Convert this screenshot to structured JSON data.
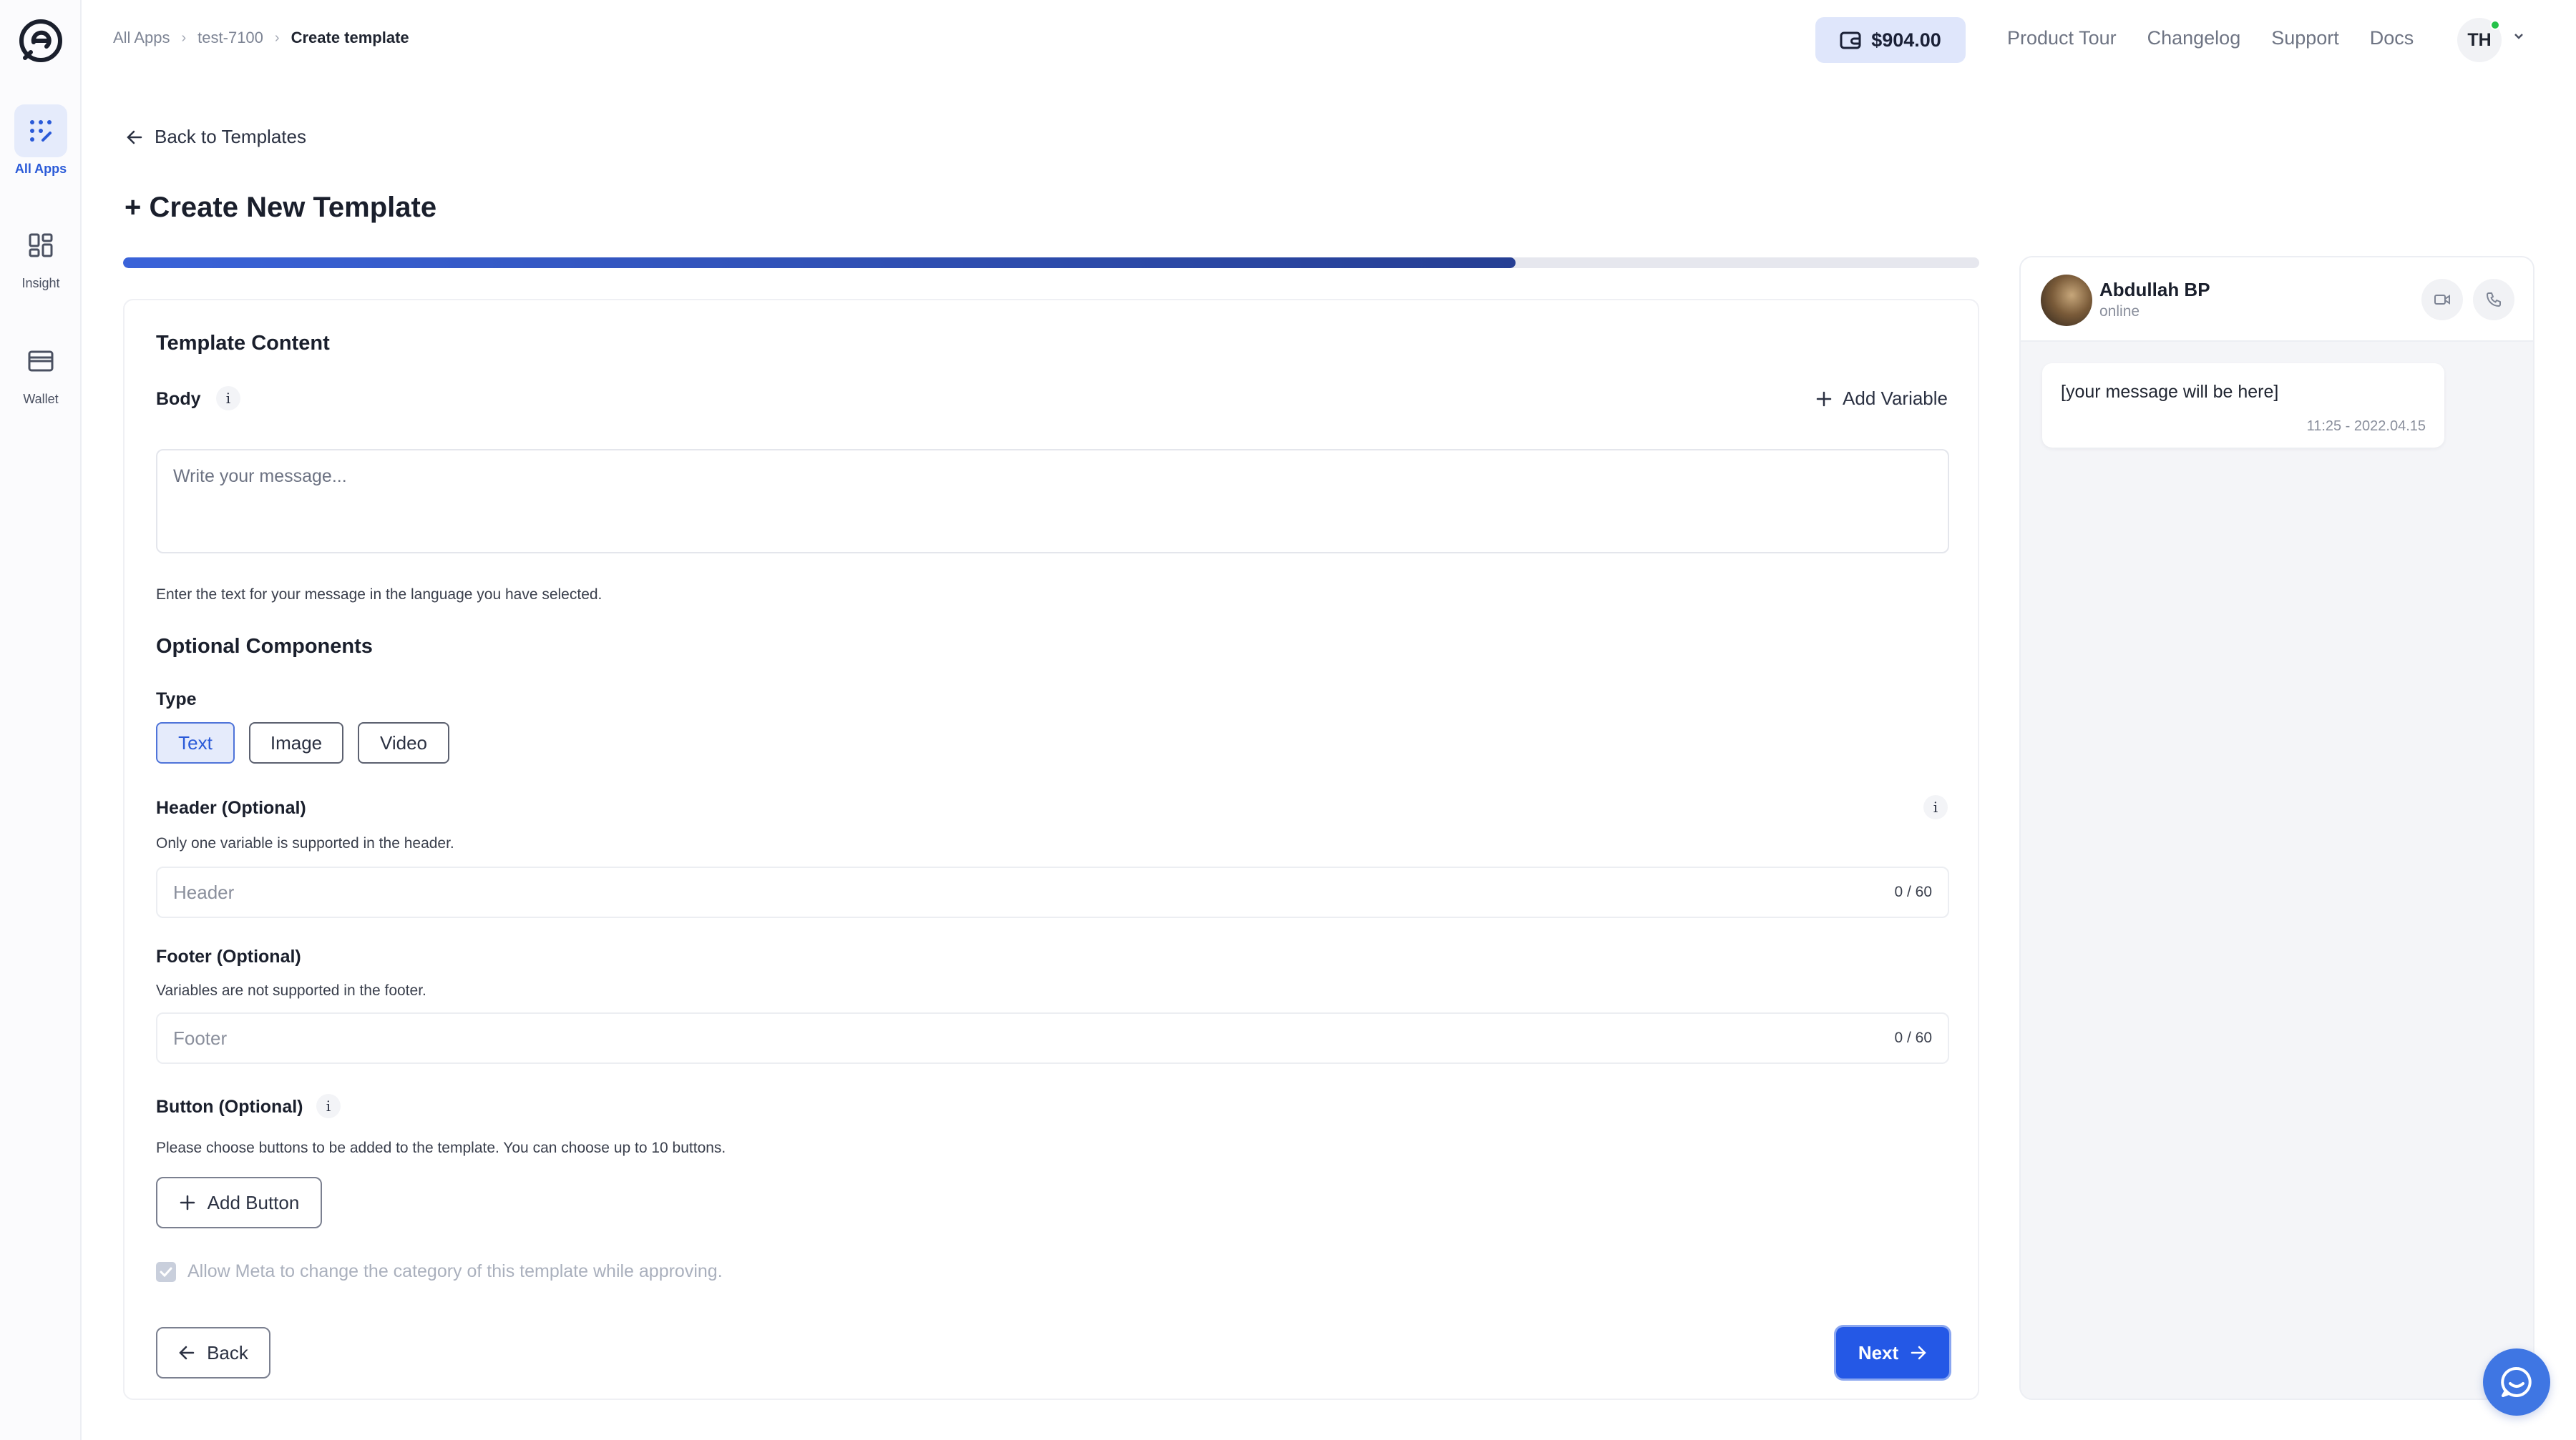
{
  "breadcrumb": {
    "items": [
      "All Apps",
      "test-7100"
    ],
    "current": "Create template"
  },
  "sidebar": {
    "items": [
      {
        "label": "All Apps",
        "icon": "apps-icon",
        "active": true
      },
      {
        "label": "Insight",
        "icon": "insight-icon",
        "active": false
      },
      {
        "label": "Wallet",
        "icon": "wallet-icon",
        "active": false
      }
    ]
  },
  "topbar": {
    "wallet_balance": "$904.00",
    "links": [
      "Product Tour",
      "Changelog",
      "Support",
      "Docs"
    ],
    "user_initials": "TH"
  },
  "main": {
    "back_link": "Back to Templates",
    "title": "+ Create New Template",
    "progress_fraction": 0.75
  },
  "form": {
    "section_title": "Template Content",
    "body_label": "Body",
    "add_variable": "Add Variable",
    "body_placeholder": "Write your message...",
    "body_help": "Enter the text for your message in the language you have selected.",
    "optional_title": "Optional Components",
    "type_label": "Type",
    "type_options": [
      "Text",
      "Image",
      "Video"
    ],
    "type_selected": "Text",
    "header_label": "Header (Optional)",
    "header_help": "Only one variable is supported in the header.",
    "header_placeholder": "Header",
    "header_count": "0 / 60",
    "footer_label": "Footer (Optional)",
    "footer_help": "Variables are not supported in the footer.",
    "footer_placeholder": "Footer",
    "footer_count": "0 / 60",
    "button_label": "Button (Optional)",
    "button_help": "Please choose buttons to be added to the template. You can choose up to 10 buttons.",
    "add_button": "Add Button",
    "allow_meta": "Allow Meta to change the category of this template while approving.",
    "back": "Back",
    "next": "Next",
    "info_glyph": "i"
  },
  "preview": {
    "contact_name": "Abdullah BP",
    "contact_status": "online",
    "message": "[your message will be here]",
    "timestamp": "11:25 - 2022.04.15"
  },
  "colors": {
    "accent": "#2458e6",
    "accent_light": "#e5ebfb",
    "online": "#26c24a"
  }
}
